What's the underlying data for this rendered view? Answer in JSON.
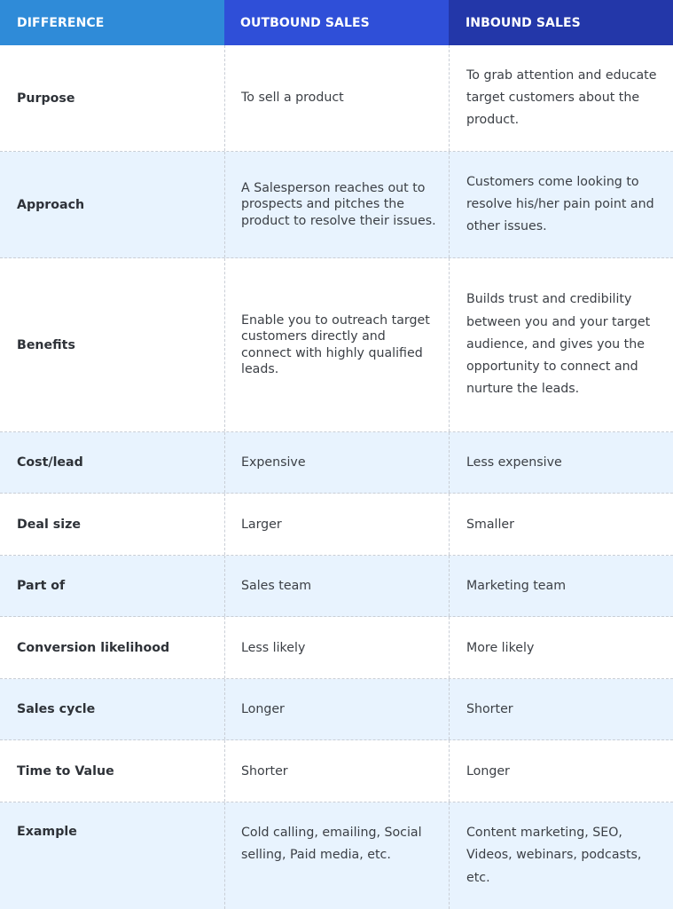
{
  "header": {
    "col1": "DIFFERENCE",
    "col2": "OUTBOUND SALES",
    "col3": "INBOUND SALES"
  },
  "colors": {
    "header_col1": "#2f8bd8",
    "header_col2": "#2f4fd8",
    "header_col3": "#2337a9",
    "row_alt_background": "#e8f3fe",
    "row_background": "#ffffff",
    "text": "#3b3f45"
  },
  "rows": [
    {
      "label": "Purpose",
      "outbound": "To sell a product",
      "inbound": "To grab attention and educate target customers about the product."
    },
    {
      "label": "Approach",
      "outbound": "A Salesperson reaches out to prospects and pitches the product to resolve their issues.",
      "inbound": "Customers come looking to resolve his/her pain point and other issues."
    },
    {
      "label": "Benefits",
      "outbound": "Enable you to outreach target customers directly and connect with highly qualified leads.",
      "inbound": "Builds trust and credibility between you and your target audience, and gives you the opportunity to connect and nurture the leads."
    },
    {
      "label": "Cost/lead",
      "outbound": "Expensive",
      "inbound": "Less expensive"
    },
    {
      "label": "Deal size",
      "outbound": "Larger",
      "inbound": "Smaller"
    },
    {
      "label": "Part of",
      "outbound": "Sales team",
      "inbound": "Marketing team"
    },
    {
      "label": "Conversion likelihood",
      "outbound": "Less likely",
      "inbound": "More likely"
    },
    {
      "label": "Sales cycle",
      "outbound": "Longer",
      "inbound": "Shorter"
    },
    {
      "label": "Time to Value",
      "outbound": "Shorter",
      "inbound": "Longer"
    },
    {
      "label": "Example",
      "outbound": "Cold calling, emailing, Social selling, Paid media, etc.",
      "inbound": "Content marketing, SEO, Videos, webinars, podcasts, etc."
    }
  ]
}
